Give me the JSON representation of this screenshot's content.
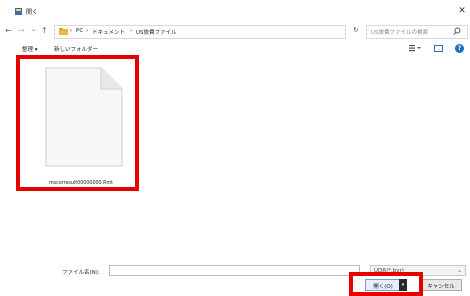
{
  "window": {
    "title": "開く",
    "close_glyph": "✕"
  },
  "nav": {
    "back": "←",
    "forward": "→",
    "recent": "⌄",
    "up": "↑",
    "breadcrumb": [
      "PC",
      "ドキュメント",
      "US旅費ファイル"
    ],
    "separator": "›",
    "dropdown": "∨",
    "refresh": "↻"
  },
  "search": {
    "placeholder": "US旅費ファイルの検索",
    "icon": "search-icon"
  },
  "toolbar": {
    "organize_label": "整理 ▾",
    "new_folder_label": "新しいフォルダー",
    "help": "?"
  },
  "files": [
    {
      "name": "mscorresult00000000.Rmt",
      "icon": "document-icon"
    }
  ],
  "footer": {
    "filename_label": "ファイル名(N):",
    "filename_value": "",
    "filetype_label": "UDR(*.bvr)",
    "open_label": "開く(O)",
    "cancel_label": "キャンセル"
  },
  "colors": {
    "highlight": "#e60000",
    "accent": "#1f6fc5",
    "folder": "#e8b93a"
  }
}
